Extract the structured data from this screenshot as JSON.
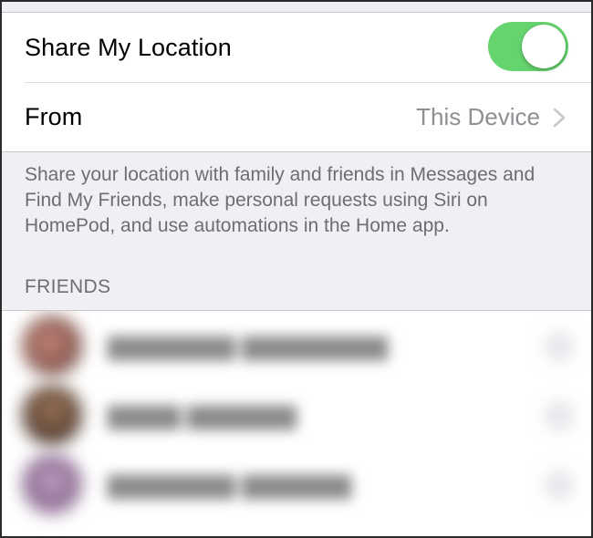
{
  "location": {
    "share_label": "Share My Location",
    "share_enabled": true,
    "from_label": "From",
    "from_value": "This Device"
  },
  "footer": "Share your location with family and friends in Messages and Find My Friends, make personal requests using Siri on HomePod, and use automations in the Home app.",
  "friends": {
    "header": "FRIENDS"
  },
  "colors": {
    "toggle_on": "#65d36e",
    "group_background": "#efeff4",
    "secondary_text": "#6d6d72"
  }
}
